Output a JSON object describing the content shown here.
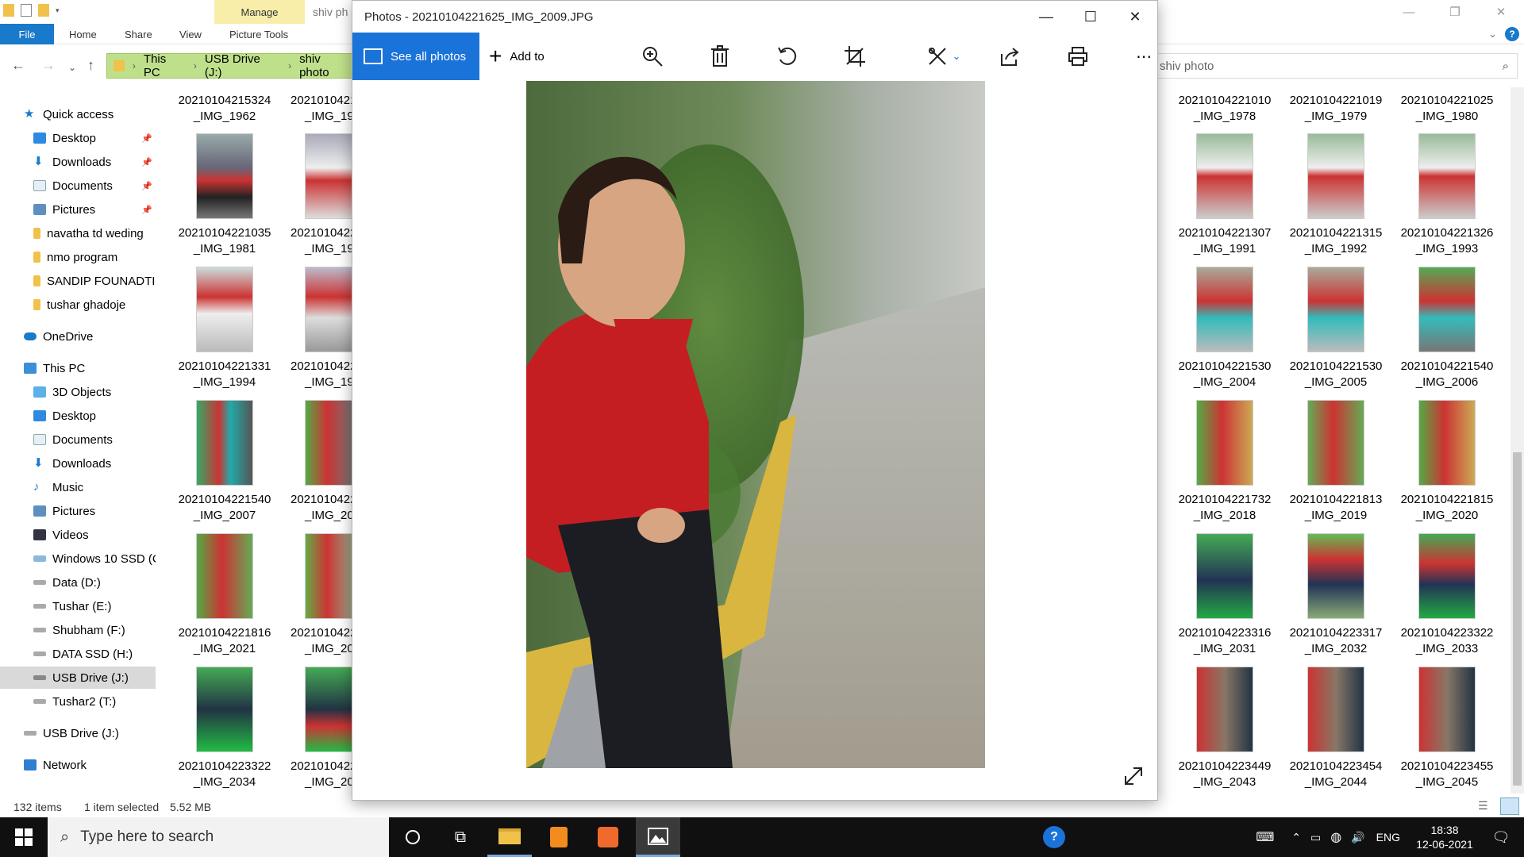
{
  "explorer": {
    "title_partial": "shiv ph",
    "contextual_tab": "Manage",
    "ribbon_tabs": [
      "File",
      "Home",
      "Share",
      "View",
      "Picture Tools"
    ],
    "address": {
      "segments": [
        "This PC",
        "USB Drive (J:)",
        "shiv photo"
      ]
    },
    "search_value": "shiv photo",
    "nav": {
      "quick_access": "Quick access",
      "quick_items": [
        "Desktop",
        "Downloads",
        "Documents",
        "Pictures",
        "navatha td weding",
        "nmo program",
        "SANDIP FOUNADTI",
        "tushar ghadoje"
      ],
      "onedrive": "OneDrive",
      "this_pc": "This PC",
      "pc_items": [
        "3D Objects",
        "Desktop",
        "Documents",
        "Downloads",
        "Music",
        "Pictures",
        "Videos",
        "Windows 10 SSD (C",
        "Data (D:)",
        "Tushar (E:)",
        "Shubham (F:)",
        "DATA SSD (H:)",
        "USB Drive (J:)",
        "Tushar2 (T:)"
      ],
      "usb": "USB Drive (J:)",
      "network": "Network"
    },
    "left_files": [
      [
        "20210104215324",
        "_IMG_1962"
      ],
      [
        "20210104221035",
        "_IMG_1981"
      ],
      [
        "20210104221331",
        "_IMG_1994"
      ],
      [
        "20210104221540",
        "_IMG_2007"
      ],
      [
        "20210104221816",
        "_IMG_2021"
      ],
      [
        "20210104223322",
        "_IMG_2034"
      ]
    ],
    "left_files_col2": [
      [
        "2021010421",
        "_IMG_19"
      ],
      [
        "2021010422",
        "_IMG_19"
      ],
      [
        "2021010422",
        "_IMG_19"
      ],
      [
        "2021010422",
        "_IMG_20"
      ],
      [
        "2021010422",
        "_IMG_20"
      ],
      [
        "2021010422",
        "_IMG_20"
      ]
    ],
    "right_files": [
      [
        [
          "20210104221010",
          "_IMG_1978"
        ],
        [
          "20210104221019",
          "_IMG_1979"
        ],
        [
          "20210104221025",
          "_IMG_1980"
        ]
      ],
      [
        [
          "20210104221307",
          "_IMG_1991"
        ],
        [
          "20210104221315",
          "_IMG_1992"
        ],
        [
          "20210104221326",
          "_IMG_1993"
        ]
      ],
      [
        [
          "20210104221530",
          "_IMG_2004"
        ],
        [
          "20210104221530",
          "_IMG_2005"
        ],
        [
          "20210104221540",
          "_IMG_2006"
        ]
      ],
      [
        [
          "20210104221732",
          "_IMG_2018"
        ],
        [
          "20210104221813",
          "_IMG_2019"
        ],
        [
          "20210104221815",
          "_IMG_2020"
        ]
      ],
      [
        [
          "20210104223316",
          "_IMG_2031"
        ],
        [
          "20210104223317",
          "_IMG_2032"
        ],
        [
          "20210104223322",
          "_IMG_2033"
        ]
      ],
      [
        [
          "20210104223449",
          "_IMG_2043"
        ],
        [
          "20210104223454",
          "_IMG_2044"
        ],
        [
          "20210104223455",
          "_IMG_2045"
        ]
      ]
    ],
    "status": {
      "items": "132 items",
      "selected": "1 item selected",
      "size": "5.52 MB"
    }
  },
  "photos": {
    "title": "Photos - 20210104221625_IMG_2009.JPG",
    "see_all": "See all photos",
    "add_to": "Add to"
  },
  "taskbar": {
    "search_placeholder": "Type here to search",
    "lang": "ENG",
    "time": "18:38",
    "date": "12-06-2021"
  },
  "colors": {
    "accent": "#1a73d9",
    "address_bar": "#bfe08a",
    "taskbar": "#101010"
  }
}
